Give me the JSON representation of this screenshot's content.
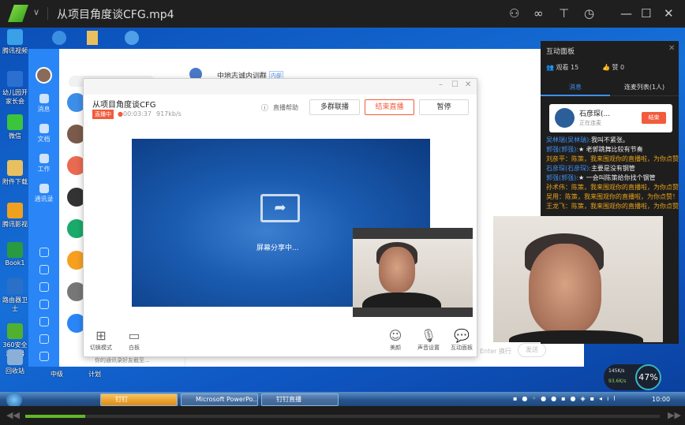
{
  "player": {
    "title": "从项目角度谈CFG.mp4",
    "icons": [
      "user-badge-icon",
      "link-icon",
      "tshirt-skin-icon",
      "clock-history-icon",
      "minimize-icon",
      "maximize-icon",
      "close-icon"
    ],
    "progress_percent": 9.5
  },
  "desktop": {
    "icons_left": [
      "腾讯视频",
      "幼儿园开家长会",
      "微信",
      "附件下载",
      "腾讯影视",
      "Book1",
      "路由器卫士",
      "360安全浏览器",
      "回收站"
    ],
    "icons_bottom": [
      "中级",
      "计划"
    ]
  },
  "dingtalk": {
    "sidebar": [
      {
        "label": "消息",
        "icon": "message-icon"
      },
      {
        "label": "文档",
        "icon": "doc-icon"
      },
      {
        "label": "工作",
        "icon": "apps-icon"
      },
      {
        "label": "通讯录",
        "icon": "contacts-icon"
      }
    ],
    "sidebar_small_icons": [
      "calendar-icon",
      "todo-icon",
      "ding-icon",
      "phone-icon",
      "mail-icon",
      "recycle-icon",
      "more-icon"
    ],
    "chat_title": "中地志诚内训群",
    "chat_badge": "内部",
    "input_hint": "Enter 换行",
    "send_label": "发送",
    "list_preview": "你的通讯录好友截至..."
  },
  "live": {
    "title": "从项目角度谈CFG",
    "status_badge": "直播中",
    "duration": "00:03:37",
    "bitrate": "917kb/s",
    "help": "直播帮助",
    "buttons": [
      "多群联播",
      "结束直播",
      "暂停"
    ],
    "share_text": "屏幕分享中...",
    "tools_left": [
      {
        "label": "切换模式",
        "icon": "grid-icon"
      },
      {
        "label": "白板",
        "icon": "whiteboard-icon"
      }
    ],
    "tools_right": [
      {
        "label": "美颜",
        "icon": "smile-icon"
      },
      {
        "label": "声音设置",
        "icon": "mic-icon"
      },
      {
        "label": "互动面板",
        "icon": "chat-bubble-icon"
      }
    ]
  },
  "panel": {
    "title": "互动面板",
    "viewers": "观看 15",
    "likes": "赞 0",
    "tabs": [
      "消息",
      "连麦列表(1人)"
    ],
    "active_tab": 0,
    "mic_user": {
      "name": "石彦琛(...",
      "status": "正在连麦",
      "end": "结束"
    },
    "messages": [
      {
        "name": "吴林瑞(吴林瑞):",
        "text": "我叫不紧张。",
        "c": "n",
        "t": "w"
      },
      {
        "name": "郭强(郭强):",
        "text": "★ 老郭跳舞比较有节奏",
        "c": "n",
        "t": "w"
      },
      {
        "name": "刘彦平：",
        "text": "陈策，我来围观你的直播啦，为你点赞！",
        "c": "y",
        "t": "y"
      },
      {
        "name": "石彦琛(石彦琛):",
        "text": "主要是没有钢管",
        "c": "n",
        "t": "w"
      },
      {
        "name": "郭强(郭强):",
        "text": "★ 一会叫陈策给你找个钢管",
        "c": "n",
        "t": "w"
      },
      {
        "name": "孙术伟：",
        "text": "陈策，我来围观你的直播啦，为你点赞！",
        "c": "y",
        "t": "y"
      },
      {
        "name": "吴用：",
        "text": "陈策，我来围观你的直播啦，为你点赞！",
        "c": "y",
        "t": "y"
      },
      {
        "name": "王龙飞：",
        "text": "陈策，我来围观你的直播啦，为你点赞！",
        "c": "y",
        "t": "y"
      }
    ]
  },
  "taskbar": {
    "tasks": [
      "钉钉",
      "Microsoft PowerPo...",
      "钉钉直播"
    ],
    "clock": "10:00",
    "net_up": "145K/s",
    "net_down": "93.6K/s",
    "cpu": "47%"
  },
  "colors": {
    "accent_red": "#f25b3b",
    "ding_blue": "#2a86f7",
    "progress_green": "#5fb82a"
  }
}
